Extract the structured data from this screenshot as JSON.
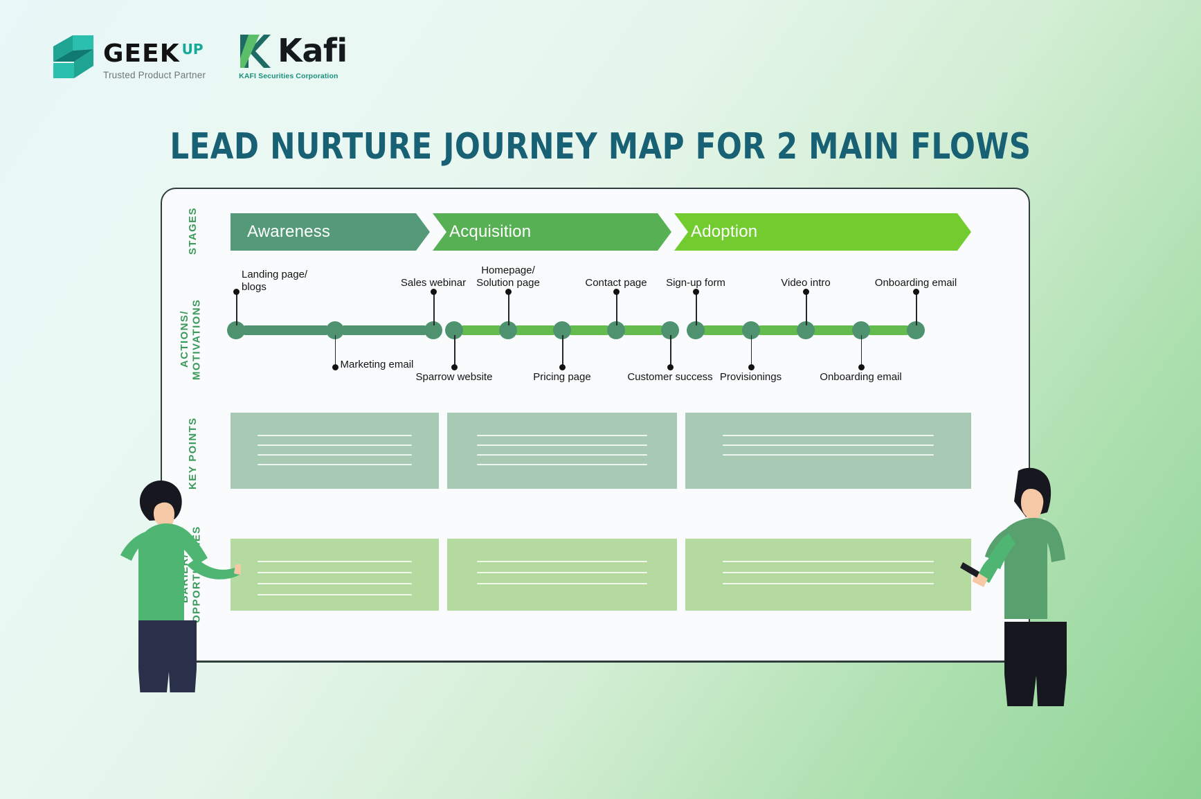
{
  "brand": {
    "geekup": {
      "name": "GEEK",
      "suffix": "UP",
      "tagline": "Trusted Product Partner",
      "mark_icon": "geekup-s-mark-icon",
      "accent": "#16a89a"
    },
    "kafi": {
      "name": "Kafi",
      "subtitle": "KAFI Securities Corporation",
      "mark_icon": "kafi-k-mark-icon",
      "accent": "#1a8f7e"
    }
  },
  "title": "LEAD NURTURE JOURNEY MAP FOR 2 MAIN FLOWS",
  "title_color": "#186073",
  "row_labels": {
    "stages": "STAGES",
    "actions": "ACTIONS/\nMOTIVATIONS",
    "actions_line1": "ACTIONS/",
    "actions_line2": "MOTIVATIONS",
    "key_points": "KEY POINTS",
    "barier_line1": "BARIER/",
    "barier_line2": "OPPORTUNITIES",
    "color": "#3a9a5a"
  },
  "stages": [
    {
      "label": "Awareness",
      "color": "#559a78"
    },
    {
      "label": "Acquisition",
      "color": "#58b054"
    },
    {
      "label": "Adoption",
      "color": "#72cc30"
    }
  ],
  "timeline": {
    "dot_color": "#4f9270",
    "bar_colors": [
      "#4f9270",
      "#64bc4e",
      "#64bc4e"
    ],
    "groups": [
      {
        "stage": "Awareness",
        "nodes": [
          {
            "label": "Landing page/\nblogs",
            "label_line1": "Landing page/",
            "label_line2": "blogs",
            "position": "above"
          },
          {
            "label": "Marketing email",
            "position": "below"
          },
          {
            "label": "Sales webinar",
            "position": "above"
          }
        ]
      },
      {
        "stage": "Acquisition",
        "nodes": [
          {
            "label": "Sparrow website",
            "position": "below"
          },
          {
            "label": "Homepage/\nSolution page",
            "label_line1": "Homepage/",
            "label_line2": "Solution page",
            "position": "above"
          },
          {
            "label": "Pricing page",
            "position": "below"
          },
          {
            "label": "Contact page",
            "position": "above"
          },
          {
            "label": "Customer success",
            "position": "below"
          }
        ]
      },
      {
        "stage": "Adoption",
        "nodes": [
          {
            "label": "Sign-up form",
            "position": "above"
          },
          {
            "label": "Provisionings",
            "position": "below"
          },
          {
            "label": "Video intro",
            "position": "above"
          },
          {
            "label": "Onboarding email",
            "position": "below"
          },
          {
            "label": "Onboarding email",
            "position": "above"
          }
        ]
      }
    ]
  },
  "key_points": {
    "color": "#a8c9b4",
    "boxes": [
      {
        "placeholder_lines": 4
      },
      {
        "placeholder_lines": 4
      },
      {
        "placeholder_lines": 3
      }
    ]
  },
  "barier_opportunities": {
    "color": "#b4daa0",
    "boxes": [
      {
        "placeholder_lines": 4
      },
      {
        "placeholder_lines": 3
      },
      {
        "placeholder_lines": 3
      }
    ]
  },
  "illustrations": {
    "left": "person-presenting-icon",
    "right": "person-writing-icon"
  }
}
